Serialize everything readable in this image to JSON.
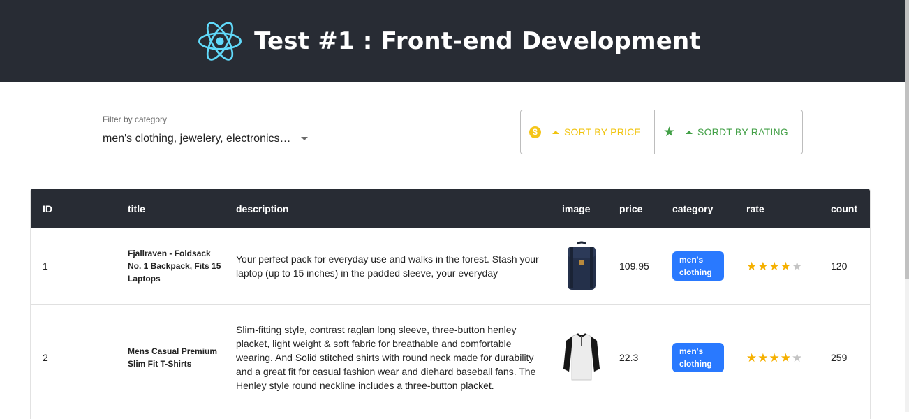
{
  "header": {
    "title": "Test #1 : Front-end Development",
    "logo_icon": "react-atom-icon"
  },
  "filter": {
    "label": "Filter by category",
    "value": "men's clothing, jewelery, electronics…"
  },
  "sort": {
    "price_label": "SORT BY PRICE",
    "rating_label": "SORDT BY RATING",
    "price_color": "#f1c40f",
    "rating_color": "#43a047"
  },
  "table": {
    "columns": [
      "ID",
      "title",
      "description",
      "image",
      "price",
      "category",
      "rate",
      "count"
    ],
    "rows": [
      {
        "id": "1",
        "title": "Fjallraven - Foldsack No. 1 Backpack, Fits 15 Laptops",
        "description": "Your perfect pack for everyday use and walks in the forest. Stash your laptop (up to 15 inches) in the padded sleeve, your everyday",
        "image_icon": "backpack-image",
        "price": "109.95",
        "category": "men's clothing",
        "rating": 4,
        "count": "120"
      },
      {
        "id": "2",
        "title": "Mens Casual Premium Slim Fit T-Shirts",
        "description": "Slim-fitting style, contrast raglan long sleeve, three-button henley placket, light weight & soft fabric for breathable and comfortable wearing. And Solid stitched shirts with round neck made for durability and a great fit for casual fashion wear and diehard baseball fans. The Henley style round neckline includes a three-button placket.",
        "image_icon": "tshirt-image",
        "price": "22.3",
        "category": "men's clothing",
        "rating": 4,
        "count": "259"
      }
    ]
  }
}
